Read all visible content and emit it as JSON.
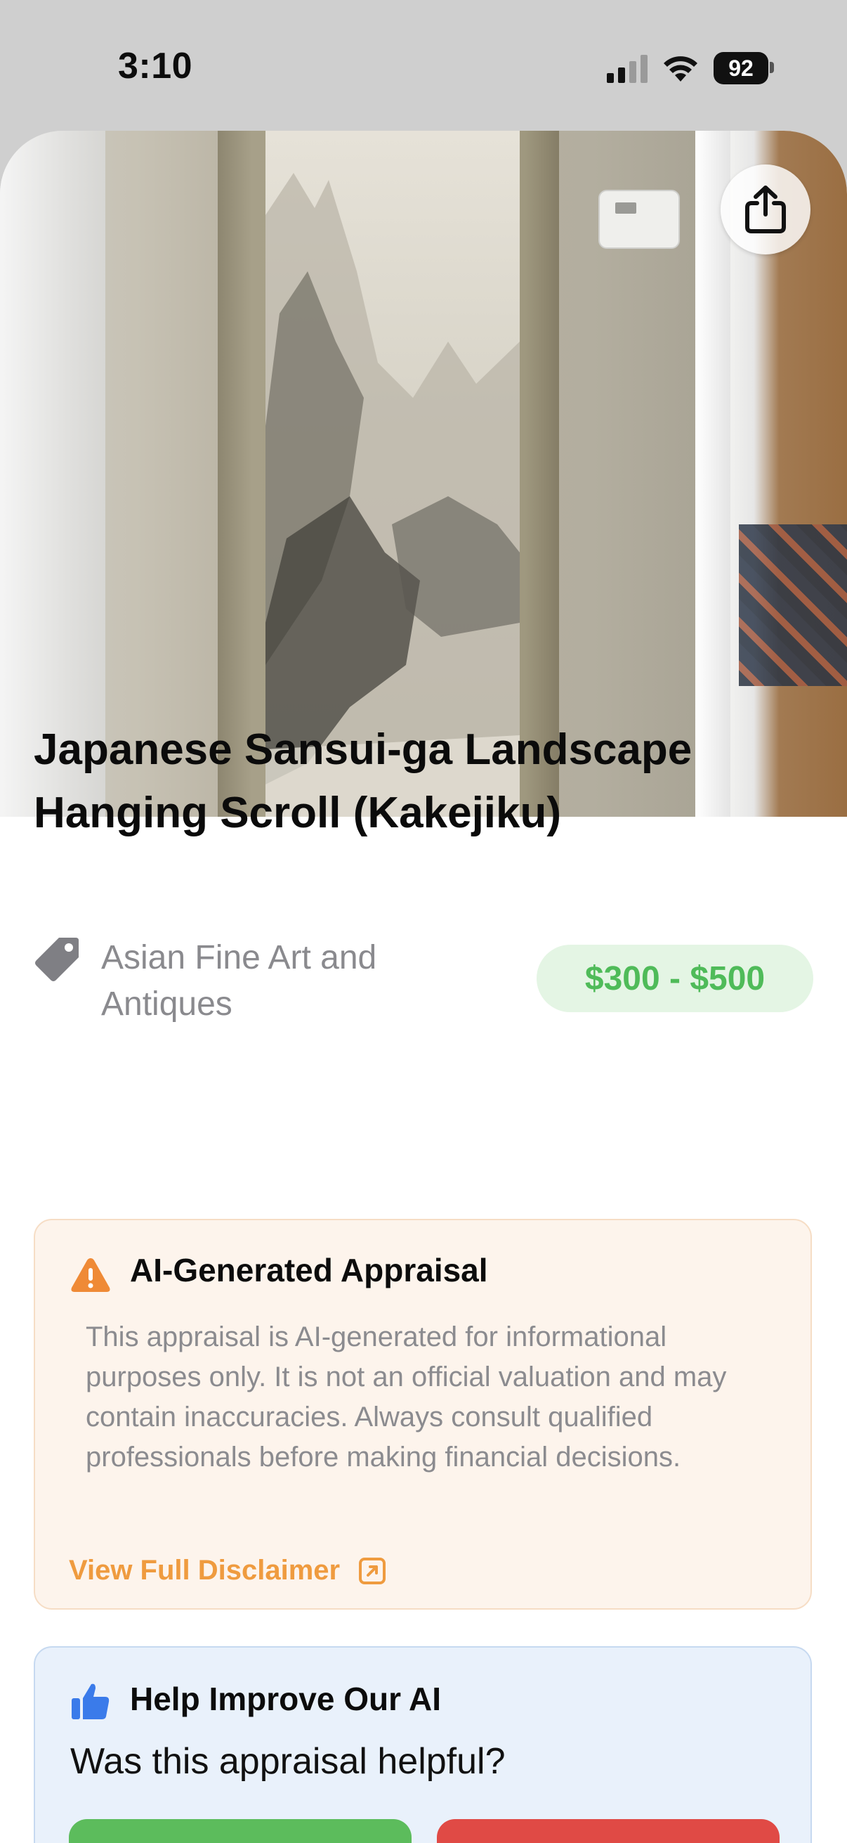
{
  "status_bar": {
    "time": "3:10",
    "battery": "92"
  },
  "photo": {
    "share_icon": "share-icon"
  },
  "item": {
    "title": "Japanese Sansui-ga Landscape Hanging Scroll (Kakejiku)",
    "category": "Asian Fine Art and Antiques",
    "price_range": "$300 - $500"
  },
  "disclaimer": {
    "title": "AI-Generated Appraisal",
    "body": "This appraisal is AI-generated for informational purposes only. It is not an official valuation and may contain inaccuracies. Always consult qualified professionals before making financial decisions.",
    "link_label": "View Full Disclaimer",
    "icon": "warning-icon",
    "accent": "#ef9b3f"
  },
  "feedback": {
    "title": "Help Improve Our AI",
    "question": "Was this appraisal helpful?",
    "icon": "thumbs-up-icon",
    "yes_color": "#5cbc5c",
    "no_color": "#e04a45"
  },
  "colors": {
    "price_green": "#4fbb59",
    "price_bg": "#e4f5e4"
  }
}
